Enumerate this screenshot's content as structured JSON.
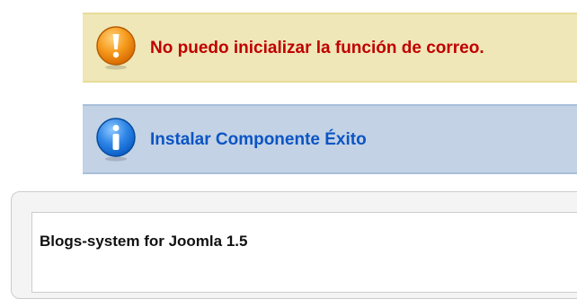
{
  "messages": {
    "error": {
      "icon": "warning-icon",
      "text": "No puedo inicializar la función de correo.",
      "color": "#c00000",
      "background": "#efe7b8"
    },
    "info": {
      "icon": "info-icon",
      "text": "Instalar Componente Éxito",
      "color": "#0b55c4",
      "background": "#c3d2e5"
    }
  },
  "component": {
    "title": "Blogs-system for Joomla 1.5"
  }
}
